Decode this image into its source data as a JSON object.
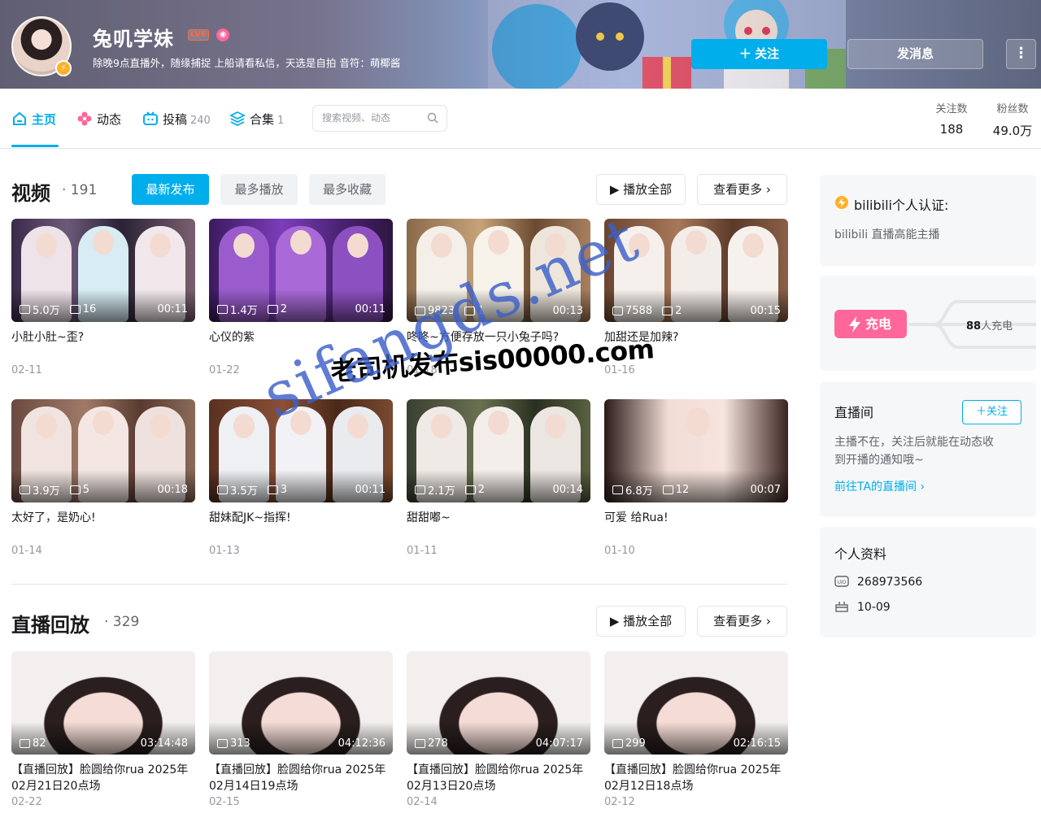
{
  "profile": {
    "name": "兔叽学妹",
    "level": "LV6",
    "sign": "除晚9点直播外，随缘捕捉 上船请看私信，天选是自拍 音符：萌椰酱",
    "follow_label": "＋ 关注",
    "message_label": "发消息",
    "more_label": "⋮"
  },
  "nav": {
    "tabs": [
      {
        "label": "主页",
        "count": ""
      },
      {
        "label": "动态",
        "count": ""
      },
      {
        "label": "投稿",
        "count": "240"
      },
      {
        "label": "合集",
        "count": "1"
      }
    ],
    "search_placeholder": "搜索视频、动态",
    "stats": [
      {
        "label": "关注数",
        "value": "188"
      },
      {
        "label": "粉丝数",
        "value": "49.0万"
      }
    ]
  },
  "videos": {
    "title": "视频",
    "count": "· 191",
    "sort_tabs": [
      "最新发布",
      "最多播放",
      "最多收藏"
    ],
    "play_all": "▶ 播放全部",
    "see_more": "查看更多 ›",
    "items": [
      {
        "plays": "5.0万",
        "comments": "16",
        "duration": "00:11",
        "title": "小肚小肚~歪?",
        "date": "02-11"
      },
      {
        "plays": "1.4万",
        "comments": "2",
        "duration": "00:11",
        "title": "心仪的紫",
        "date": "01-22"
      },
      {
        "plays": "9823",
        "comments": "1",
        "duration": "00:13",
        "title": "咚咚~方便存放一只小兔子吗?",
        "date": "01-18"
      },
      {
        "plays": "7588",
        "comments": "2",
        "duration": "00:15",
        "title": "加甜还是加辣?",
        "date": "01-16"
      },
      {
        "plays": "3.9万",
        "comments": "5",
        "duration": "00:18",
        "title": "太好了，是奶心!",
        "date": "01-14"
      },
      {
        "plays": "3.5万",
        "comments": "3",
        "duration": "00:11",
        "title": "甜妹配JK~指挥!",
        "date": "01-13"
      },
      {
        "plays": "2.1万",
        "comments": "2",
        "duration": "00:14",
        "title": "甜甜嘟~",
        "date": "01-11"
      },
      {
        "plays": "6.8万",
        "comments": "12",
        "duration": "00:07",
        "title": "可爱 给Rua!",
        "date": "01-10"
      }
    ]
  },
  "replays": {
    "title": "直播回放",
    "count": "· 329",
    "play_all": "▶ 播放全部",
    "see_more": "查看更多 ›",
    "items": [
      {
        "plays": "82",
        "duration": "03:14:48",
        "title": "【直播回放】脸圆给你rua 2025年02月21日20点场",
        "date": "02-22"
      },
      {
        "plays": "313",
        "duration": "04:12:36",
        "title": "【直播回放】脸圆给你rua 2025年02月14日19点场",
        "date": "02-15"
      },
      {
        "plays": "278",
        "duration": "04:07:17",
        "title": "【直播回放】脸圆给你rua 2025年02月13日20点场",
        "date": "02-14"
      },
      {
        "plays": "299",
        "duration": "02:16:15",
        "title": "【直播回放】脸圆给你rua 2025年02月12日18点场",
        "date": "02-12"
      }
    ]
  },
  "sidebar": {
    "cert_title": "bilibili个人认证:",
    "cert_text": "bilibili 直播高能主播",
    "charge_label": "充电",
    "charge_count": "88",
    "charge_suffix": "人充电",
    "live_title": "直播间",
    "live_follow": "＋关注",
    "live_text1": "主播不在，关注后就能在动态收",
    "live_text2": "到开播的通知哦~",
    "live_link": "前往TA的直播间 ›",
    "profile_title": "个人资料",
    "uid": "268973566",
    "birthday": "10-09"
  },
  "watermark": {
    "line1": "老司机发布sis00000.com",
    "line2": "sifangds.net"
  },
  "colors": {
    "accent": "#00aeec",
    "pink": "#ff6699",
    "text": "#18191c",
    "muted": "#9499a0"
  }
}
